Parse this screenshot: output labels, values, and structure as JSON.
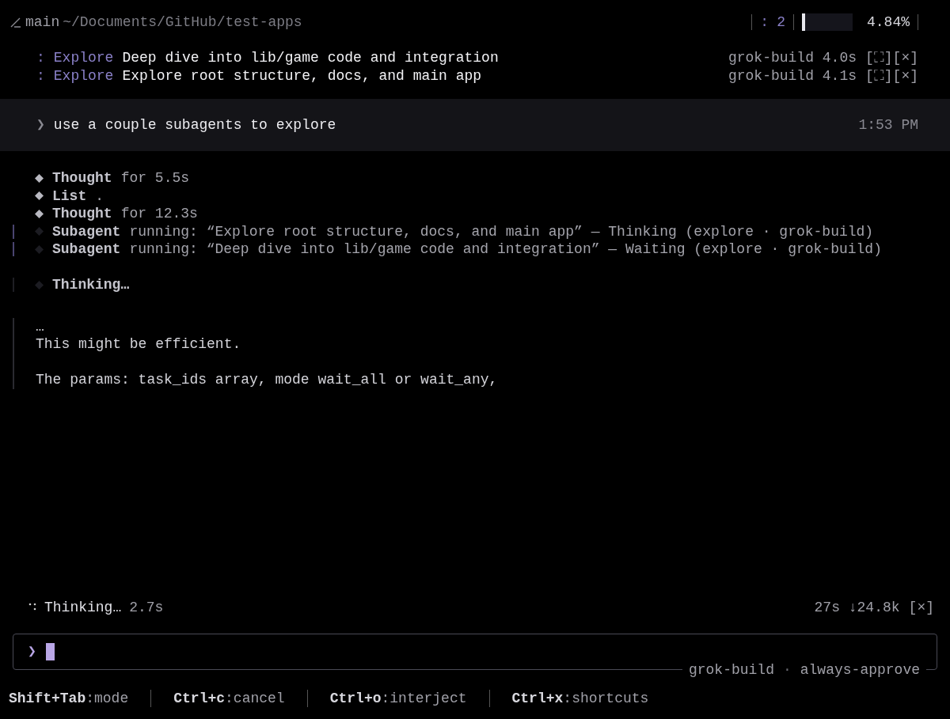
{
  "header": {
    "branch": "main",
    "path": "~/Documents/GitHub/test-apps",
    "agents_prefix": ":",
    "agents_count": "2",
    "context": {
      "level": 0.06,
      "reading": "4.84%"
    }
  },
  "tasks": [
    {
      "prefix": ":",
      "type": "Explore",
      "description": "Deep dive into lib/game code and integration",
      "model_time": "grok-build 4.0s",
      "expand": "[⛶]",
      "close": "[×]"
    },
    {
      "prefix": ":",
      "type": "Explore",
      "description": "Explore root structure, docs, and main app",
      "model_time": "grok-build 4.1s",
      "expand": "[⛶]",
      "close": "[×]"
    }
  ],
  "user_message": {
    "prompt": "❯",
    "text": "use a couple subagents to explore",
    "time": "1:53 PM"
  },
  "activity": [
    {
      "kind": "step",
      "done": true,
      "label": "Thought",
      "detail": "for 5.5s"
    },
    {
      "kind": "step",
      "done": true,
      "label": "List",
      "detail": "."
    },
    {
      "kind": "step",
      "done": true,
      "label": "Thought",
      "detail": "for 12.3s"
    },
    {
      "kind": "subagent",
      "done": false,
      "label": "Subagent",
      "detail": "running: “Explore root structure, docs, and main app” — Thinking (explore · grok-build)"
    },
    {
      "kind": "subagent",
      "done": false,
      "label": "Subagent",
      "detail": "running: “Deep dive into lib/game code and integration” — Waiting (explore · grok-build)"
    },
    {
      "kind": "gap"
    },
    {
      "kind": "thinking",
      "done": false,
      "label": "Thinking…"
    }
  ],
  "thought_lines": [
    {
      "text": "…",
      "gap_before": false
    },
    {
      "text": "This might be efficient.",
      "gap_before": false
    },
    {
      "text": "The params: task_ids array, mode wait_all or wait_any,",
      "gap_before": true
    }
  ],
  "status_line": {
    "text": "Thinking…",
    "elapsed": "2.7s",
    "stats": "27s ↓24.8k",
    "cancel": "[×]"
  },
  "input": {
    "prompt": "❯",
    "model": "grok-build",
    "separator": "·",
    "mode": "always-approve"
  },
  "shortcuts": [
    {
      "key": "Shift+Tab",
      "action": ":mode"
    },
    {
      "key": "Ctrl+c",
      "action": ":cancel"
    },
    {
      "key": "Ctrl+o",
      "action": ":interject"
    },
    {
      "key": "Ctrl+x",
      "action": ":shortcuts"
    }
  ]
}
